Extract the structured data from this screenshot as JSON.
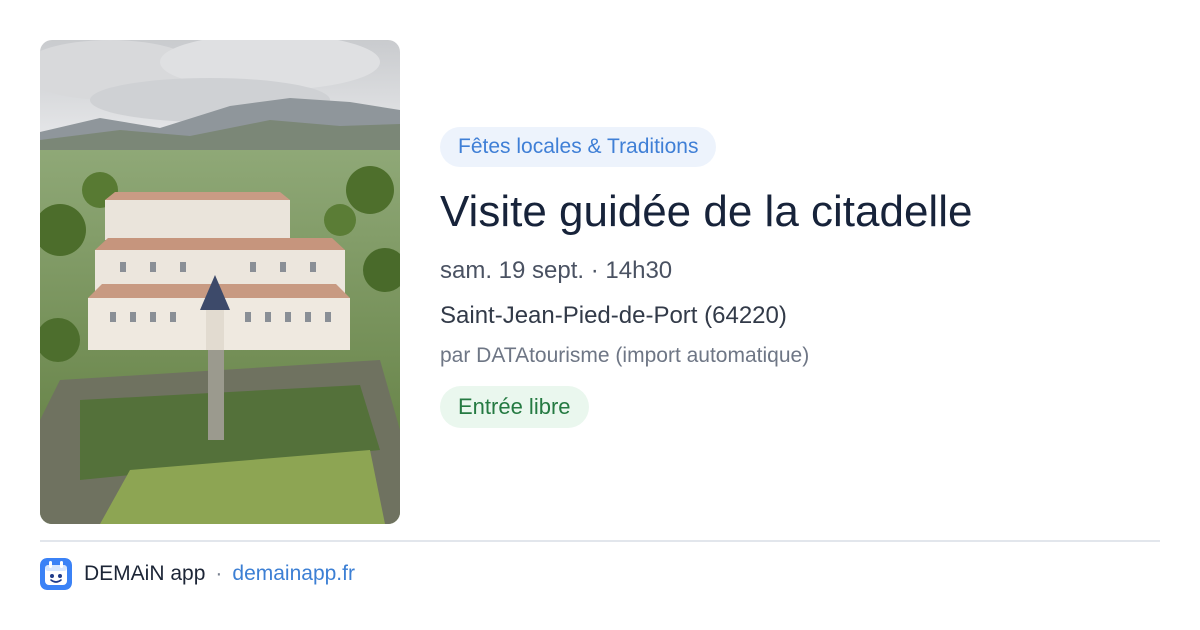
{
  "event": {
    "image_alt": "Aerial view of the citadel",
    "category": "Fêtes locales & Traditions",
    "title": "Visite guidée de la citadelle",
    "date": "sam. 19 sept. · 14h30",
    "location": "Saint-Jean-Pied-de-Port (64220)",
    "source": "par DATAtourisme (import automatique)",
    "price": "Entrée libre"
  },
  "footer": {
    "app_name": "DEMAiN app",
    "separator": "·",
    "link": "demainapp.fr",
    "icon": "demain-app-icon"
  },
  "colors": {
    "category_bg": "#edf3fc",
    "category_text": "#3f7fd6",
    "price_bg": "#eaf7ee",
    "price_text": "#257a42",
    "title": "#17233a",
    "link": "#3c7fd4",
    "brand": "#3b82f6"
  }
}
